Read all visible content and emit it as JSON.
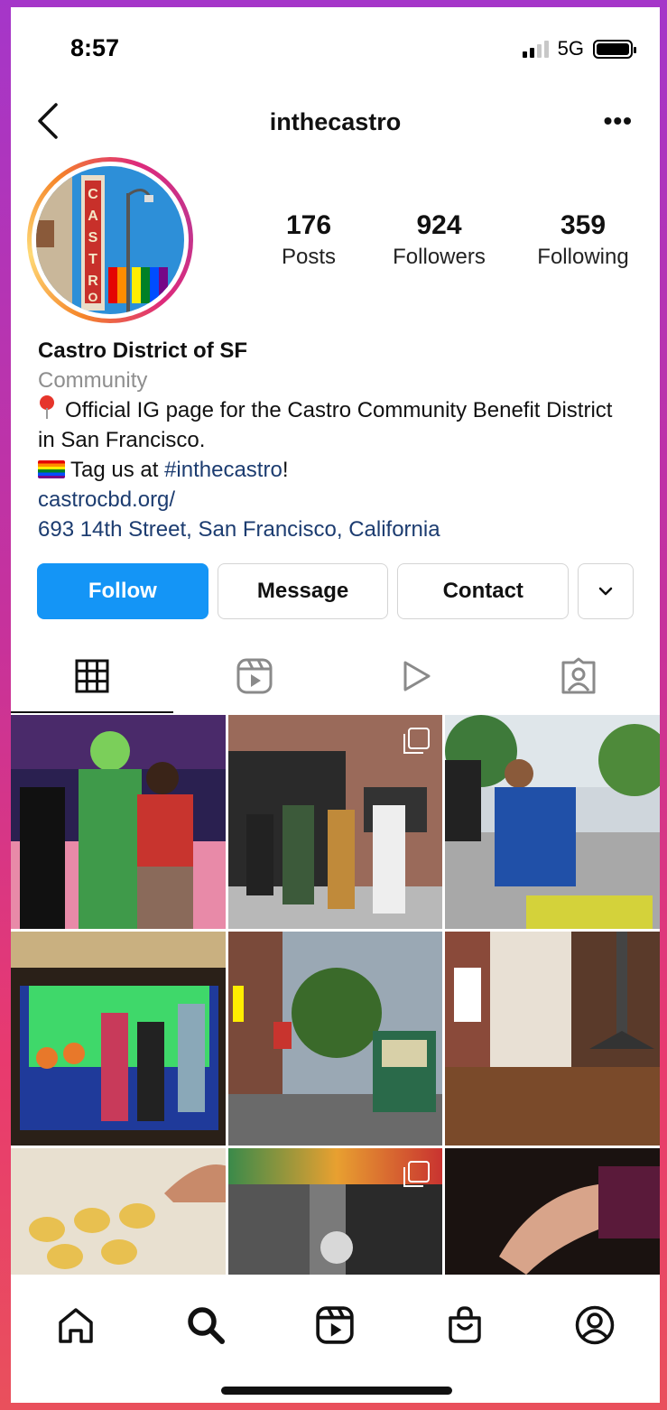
{
  "status_bar": {
    "time": "8:57",
    "network": "5G"
  },
  "header": {
    "username": "inthecastro",
    "more": "•••"
  },
  "profile": {
    "stats": [
      {
        "value": "176",
        "label": "Posts"
      },
      {
        "value": "924",
        "label": "Followers"
      },
      {
        "value": "359",
        "label": "Following"
      }
    ],
    "name": "Castro District of SF",
    "category": "Community",
    "bio_line1": "Official IG page for the Castro Community Benefit District in San Francisco.",
    "bio_line2_prefix": "Tag us at ",
    "bio_hashtag": "#inthecastro",
    "bio_line2_suffix": "!",
    "website": "castrocbd.org/",
    "address": "693 14th Street, San Francisco, California"
  },
  "actions": {
    "follow": "Follow",
    "message": "Message",
    "contact": "Contact"
  },
  "tabs": [
    "grid-icon",
    "reels-icon",
    "video-icon",
    "tagged-icon"
  ],
  "bottom_nav": [
    "home-icon",
    "search-icon",
    "reels-icon",
    "shop-icon",
    "profile-icon"
  ],
  "colors": {
    "follow_blue": "#1495f6",
    "link": "#1c3c70",
    "category_gray": "#8e8e8e"
  }
}
